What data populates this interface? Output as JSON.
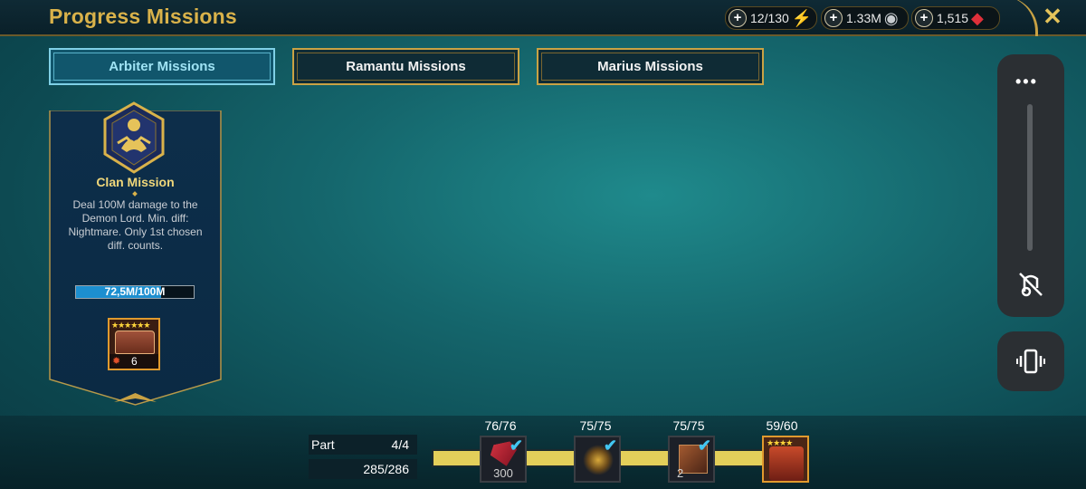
{
  "header": {
    "title": "Progress Missions",
    "resources": [
      {
        "name": "energy",
        "value": "12/130",
        "icon": "lightning-icon",
        "color": "#f4e23a"
      },
      {
        "name": "silver",
        "value": "1.33M",
        "icon": "silver-coin-icon",
        "color": "#c8ccd0"
      },
      {
        "name": "gems",
        "value": "1,515",
        "icon": "ruby-icon",
        "color": "#e0303a"
      }
    ],
    "close_label": "✕"
  },
  "tabs": [
    {
      "label": "Arbiter Missions",
      "active": true
    },
    {
      "label": "Ramantu Missions",
      "active": false
    },
    {
      "label": "Marius Missions",
      "active": false
    }
  ],
  "mission": {
    "title": "Clan Mission",
    "description": "Deal 100M damage to the Demon Lord. Min. diff: Nightmare. Only 1st chosen diff. counts.",
    "progress_text": "72,5M/100M",
    "progress_fraction": 0.725,
    "reward": {
      "stars": "★★★★★★",
      "count": "6"
    }
  },
  "bottom": {
    "part_label": "Part",
    "part_value": "4/4",
    "points_value": "285/286",
    "milestones": [
      {
        "count": "76/76",
        "reward": "ruby",
        "amount": "300",
        "claimed": true
      },
      {
        "count": "75/75",
        "reward": "weapon",
        "amount": "",
        "claimed": true
      },
      {
        "count": "75/75",
        "reward": "tome",
        "amount": "2",
        "claimed": true
      },
      {
        "count": "59/60",
        "reward": "champion",
        "amount": "",
        "claimed": false,
        "stars": "★★★★"
      }
    ]
  },
  "side_controls": {
    "more_label": "•••",
    "check_mark": "✔"
  }
}
